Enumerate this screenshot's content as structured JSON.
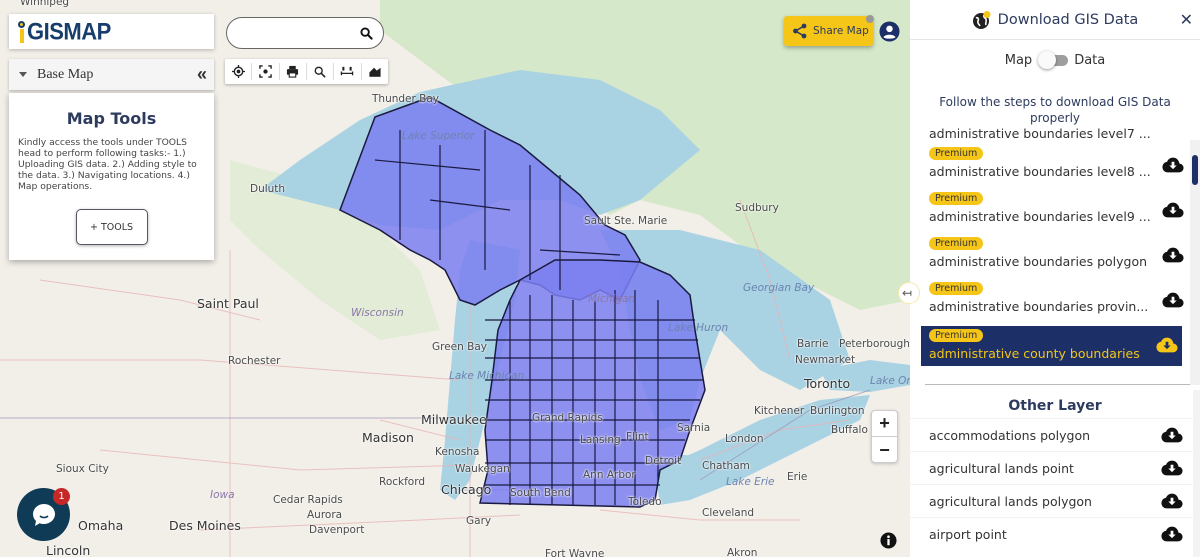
{
  "app": {
    "logo_text": "GISMAP",
    "logo_prefix": "i"
  },
  "left_panel": {
    "basemap_label": "Base Map",
    "collapse_symbol": "«",
    "tools_title": "Map Tools",
    "tools_description": "Kindly access the tools under TOOLS head to perform following tasks:- 1.) Uploading GIS data. 2.) Adding style to the data. 3.) Navigating locations. 4.) Map operations.",
    "tools_button": "+ TOOLS"
  },
  "search": {
    "value": "",
    "placeholder": ""
  },
  "toolbar": {
    "icons": [
      "locate-icon",
      "focus-icon",
      "print-icon",
      "zoom-search-icon",
      "measure-icon",
      "layers-icon"
    ]
  },
  "share": {
    "label": "Share Map"
  },
  "zoom_control": {
    "plus": "+",
    "minus": "−"
  },
  "chat": {
    "badge_count": "1"
  },
  "map": {
    "labels": [
      {
        "text": "Winnipeg",
        "kind": "city"
      },
      {
        "text": "Thunder Bay",
        "kind": "city"
      },
      {
        "text": "Lake Superior",
        "kind": "water"
      },
      {
        "text": "Duluth",
        "kind": "city"
      },
      {
        "text": "Sault Ste. Marie",
        "kind": "city"
      },
      {
        "text": "Sudbury",
        "kind": "city"
      },
      {
        "text": "Georgian Bay",
        "kind": "water"
      },
      {
        "text": "Lake Huron",
        "kind": "water"
      },
      {
        "text": "Michigan",
        "kind": "state"
      },
      {
        "text": "Saint Paul",
        "kind": "city"
      },
      {
        "text": "Wisconsin",
        "kind": "state"
      },
      {
        "text": "Green Bay",
        "kind": "city"
      },
      {
        "text": "Lake Michigan",
        "kind": "water"
      },
      {
        "text": "Rochester",
        "kind": "city"
      },
      {
        "text": "Milwaukee",
        "kind": "city"
      },
      {
        "text": "Madison",
        "kind": "city"
      },
      {
        "text": "Kenosha",
        "kind": "city"
      },
      {
        "text": "Waukegan",
        "kind": "city"
      },
      {
        "text": "Rockford",
        "kind": "city"
      },
      {
        "text": "Chicago",
        "kind": "city"
      },
      {
        "text": "Aurora",
        "kind": "city"
      },
      {
        "text": "Gary",
        "kind": "city"
      },
      {
        "text": "Sioux City",
        "kind": "city"
      },
      {
        "text": "Iowa",
        "kind": "state"
      },
      {
        "text": "Cedar Rapids",
        "kind": "city"
      },
      {
        "text": "Des Moines",
        "kind": "city"
      },
      {
        "text": "Omaha",
        "kind": "city"
      },
      {
        "text": "Lincoln",
        "kind": "city"
      },
      {
        "text": "Davenport",
        "kind": "city"
      },
      {
        "text": "Grand Rapids",
        "kind": "city"
      },
      {
        "text": "Lansing",
        "kind": "city"
      },
      {
        "text": "Flint",
        "kind": "city"
      },
      {
        "text": "Detroit",
        "kind": "city"
      },
      {
        "text": "Ann Arbor",
        "kind": "city"
      },
      {
        "text": "Toledo",
        "kind": "city"
      },
      {
        "text": "South Bend",
        "kind": "city"
      },
      {
        "text": "Sarnia",
        "kind": "city"
      },
      {
        "text": "London",
        "kind": "city"
      },
      {
        "text": "Chatham",
        "kind": "city"
      },
      {
        "text": "Lake Erie",
        "kind": "water"
      },
      {
        "text": "Erie",
        "kind": "city"
      },
      {
        "text": "Cleveland",
        "kind": "city"
      },
      {
        "text": "Kitchener",
        "kind": "city"
      },
      {
        "text": "Burlington",
        "kind": "city"
      },
      {
        "text": "Buffalo",
        "kind": "city"
      },
      {
        "text": "Toronto",
        "kind": "city"
      },
      {
        "text": "Barrie",
        "kind": "city"
      },
      {
        "text": "Newmarket",
        "kind": "city"
      },
      {
        "text": "Peterborough",
        "kind": "city"
      },
      {
        "text": "Lake Ontario",
        "kind": "water"
      },
      {
        "text": "Akron",
        "kind": "city"
      },
      {
        "text": "Fort Wayne",
        "kind": "city"
      }
    ],
    "overlay_color": "#7b7ff0"
  },
  "right_panel": {
    "title": "Download GIS Data",
    "close_symbol": "✕",
    "toggle_left": "Map",
    "toggle_right": "Data",
    "toggle_on": false,
    "steps_text": "Follow the steps to download GIS Data properly",
    "premium_items": [
      {
        "badge": "",
        "name": "administrative boundaries level7 ...",
        "selected": false
      },
      {
        "badge": "Premium",
        "name": "administrative boundaries level8 ...",
        "selected": false
      },
      {
        "badge": "Premium",
        "name": "administrative boundaries level9 ...",
        "selected": false
      },
      {
        "badge": "Premium",
        "name": "administrative boundaries polygon",
        "selected": false
      },
      {
        "badge": "Premium",
        "name": "administrative boundaries provin...",
        "selected": false
      },
      {
        "badge": "Premium",
        "name": "administrative county boundaries",
        "selected": true
      }
    ],
    "other_layer_title": "Other Layer",
    "other_items": [
      {
        "name": "accommodations polygon"
      },
      {
        "name": "agricultural lands point"
      },
      {
        "name": "agricultural lands polygon"
      },
      {
        "name": "airport point"
      }
    ]
  },
  "colors": {
    "accent_yellow": "#f5c518",
    "navy": "#1c2f66",
    "title_text": "#2d3b5e"
  }
}
